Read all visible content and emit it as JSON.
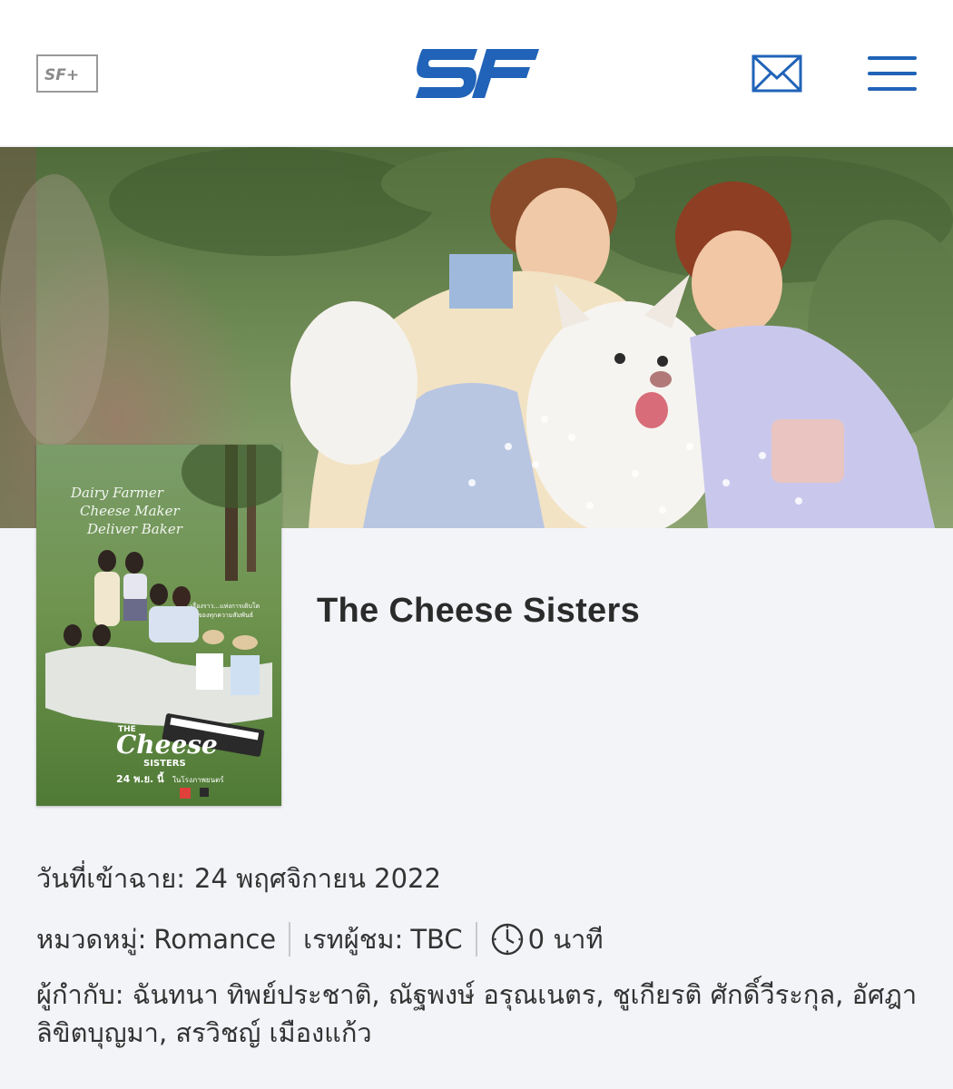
{
  "header": {
    "sf_plus_label": "SF+",
    "logo_text": "SF",
    "mail_icon": "mail-icon",
    "menu_icon": "hamburger-menu-icon",
    "brand_color": "#2063b8"
  },
  "hero": {
    "image": "banner-two-girls-with-white-dog"
  },
  "poster": {
    "script_text": "Dairy Farmer Cheese Maker Deliver Baker",
    "tagline": "เรื่องราว...แห่งการเติบโต ของทุกความสัมพันธ์",
    "logo_main": "Cheese",
    "logo_sub": "SISTERS",
    "release_line": "24 พ.ย. นี้ ในโรงภาพยนตร์"
  },
  "movie": {
    "title": "The Cheese Sisters",
    "release_label": "วันที่เข้าฉาย:",
    "release_date": "24 พฤศจิกายน 2022",
    "genre_label": "หมวดหมู่:",
    "genre": "Romance",
    "rating_label": "เรทผู้ชม:",
    "rating": "TBC",
    "duration": "0 นาที",
    "directors_label": "ผู้กำกับ:",
    "directors": "ฉันทนา ทิพย์ประชาติ, ณัฐพงษ์ อรุณเนตร, ชูเกียรติ ศักดิ์วีระกุล, อัศฎา ลิขิตบุญมา, สรวิชญ์ เมืองแก้ว"
  }
}
